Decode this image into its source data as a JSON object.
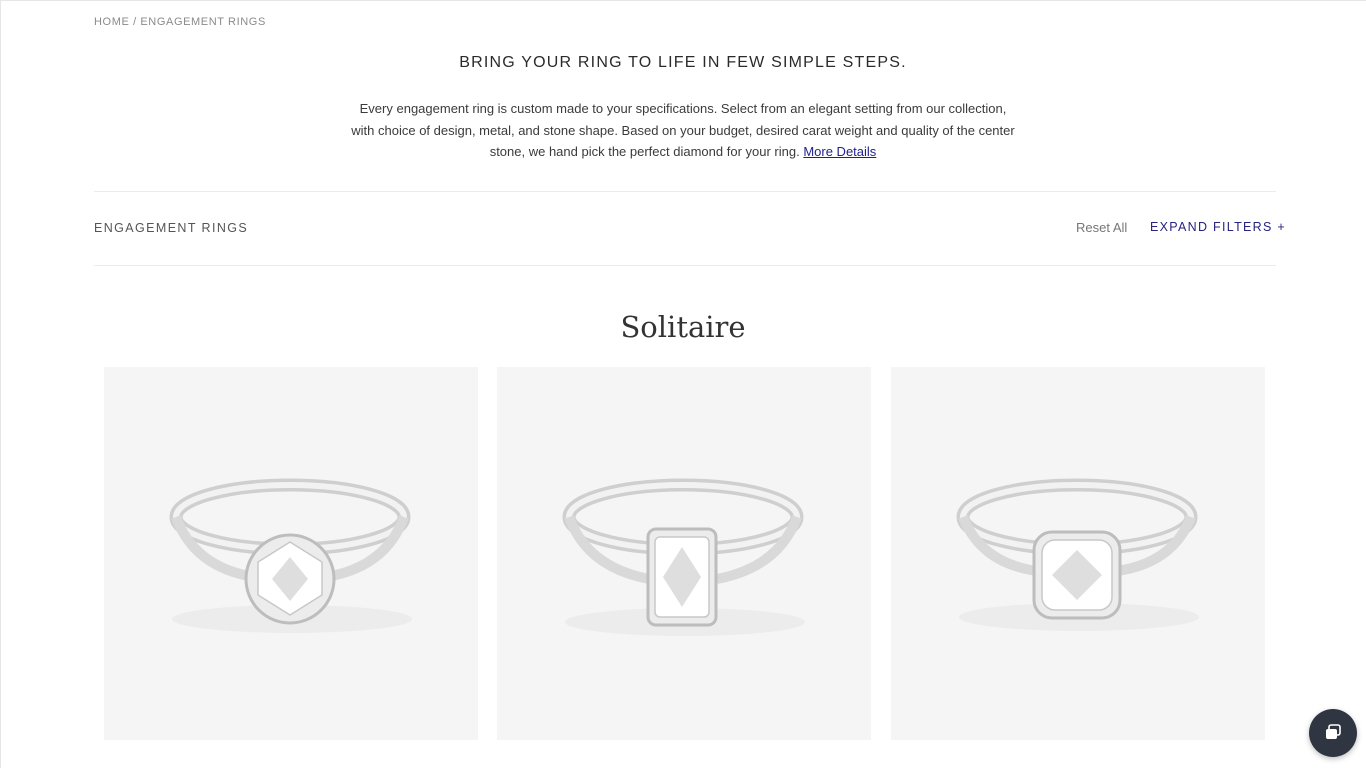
{
  "breadcrumb": {
    "home": "HOME",
    "separator": "/",
    "current": "ENGAGEMENT RINGS"
  },
  "intro": {
    "title": "BRING YOUR RING TO LIFE IN FEW SIMPLE STEPS.",
    "text": "Every engagement ring is custom made to your specifications. Select from an elegant setting from our collection, with choice of design, metal, and stone shape. Based on your budget, desired carat weight and quality of the center stone, we hand pick the perfect diamond for your ring.",
    "link": "More Details"
  },
  "filters": {
    "label": "ENGAGEMENT RINGS",
    "reset": "Reset All",
    "expand": "EXPAND FILTERS +"
  },
  "section": {
    "title": "Solitaire"
  },
  "products": [
    {
      "image": "round-solitaire-ring-image",
      "stone_shape": "round"
    },
    {
      "image": "radiant-solitaire-ring-image",
      "stone_shape": "radiant"
    },
    {
      "image": "cushion-solitaire-ring-image",
      "stone_shape": "cushion"
    }
  ],
  "chat": {
    "icon": "chat-icon"
  },
  "colors": {
    "accent": "#26247d",
    "link": "#1f1f8f",
    "card_bg": "#f5f5f5",
    "chat_bg": "#2f3541"
  }
}
